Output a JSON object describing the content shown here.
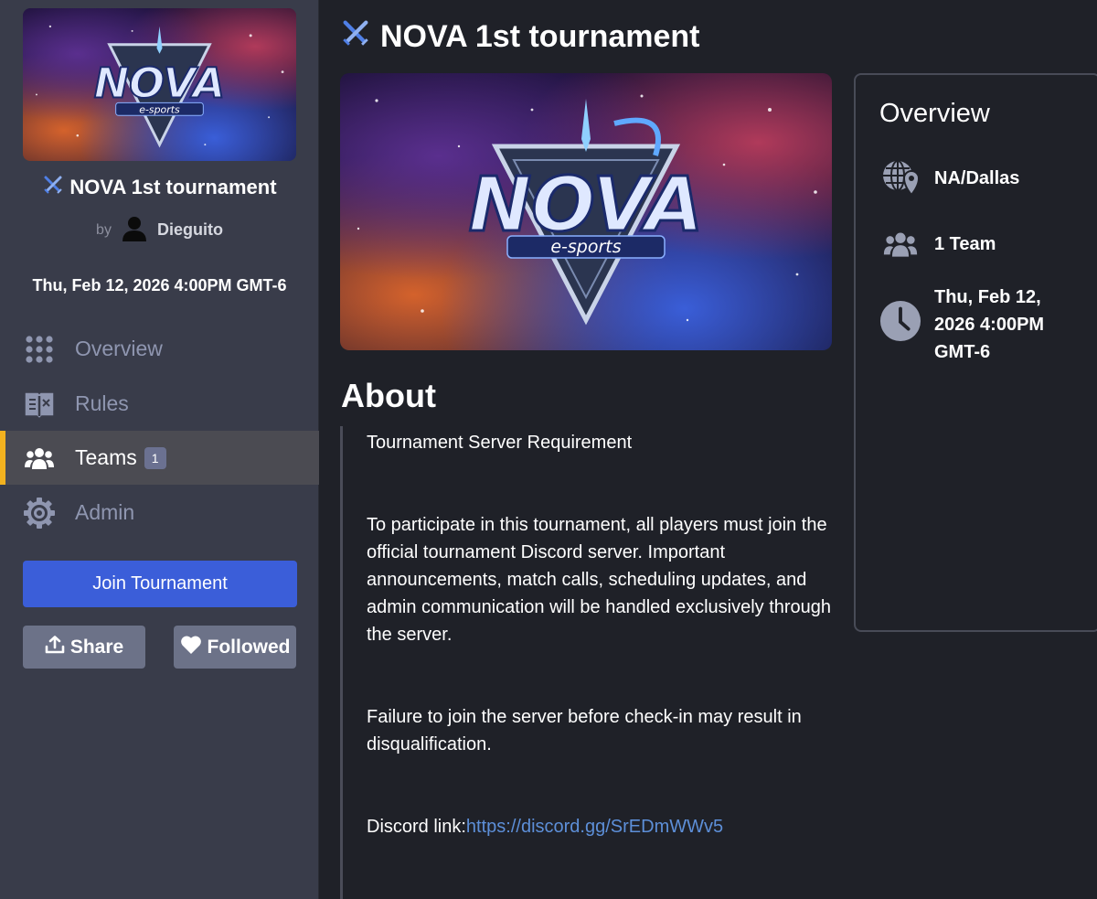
{
  "tournament": {
    "title": "NOVA 1st tournament",
    "banner_logo_text": "NOVA",
    "banner_logo_subtext": "e-sports"
  },
  "sidebar": {
    "by_label": "by",
    "author": "Dieguito",
    "date": "Thu, Feb 12, 2026 4:00PM GMT-6",
    "nav": [
      {
        "label": "Overview",
        "icon": "grid-icon",
        "active": false
      },
      {
        "label": "Rules",
        "icon": "book-icon",
        "active": false
      },
      {
        "label": "Teams",
        "icon": "users-icon",
        "active": true,
        "badge": "1"
      },
      {
        "label": "Admin",
        "icon": "gear-icon",
        "active": false
      }
    ],
    "join_label": "Join Tournament",
    "share_label": "Share",
    "followed_label": "Followed"
  },
  "about": {
    "heading": "About",
    "paragraph_1": "Tournament Server Requirement",
    "paragraph_2": "To participate in this tournament, all players must join the official tournament Discord server. Important announcements, match calls, scheduling updates, and admin communication will be handled exclusively through the server.",
    "paragraph_3": "Failure to join the server before check-in may result in disqualification.",
    "discord_label": "Discord link:",
    "discord_url": "https://discord.gg/SrEDmWWv5"
  },
  "overview": {
    "heading": "Overview",
    "location": "NA/Dallas",
    "teams": "1 Team",
    "date": "Thu, Feb 12, 2026 4:00PM GMT-6"
  },
  "colors": {
    "accent_blue": "#3b5ed9",
    "active_bar": "#f3b21f",
    "link": "#5d8fd8"
  }
}
